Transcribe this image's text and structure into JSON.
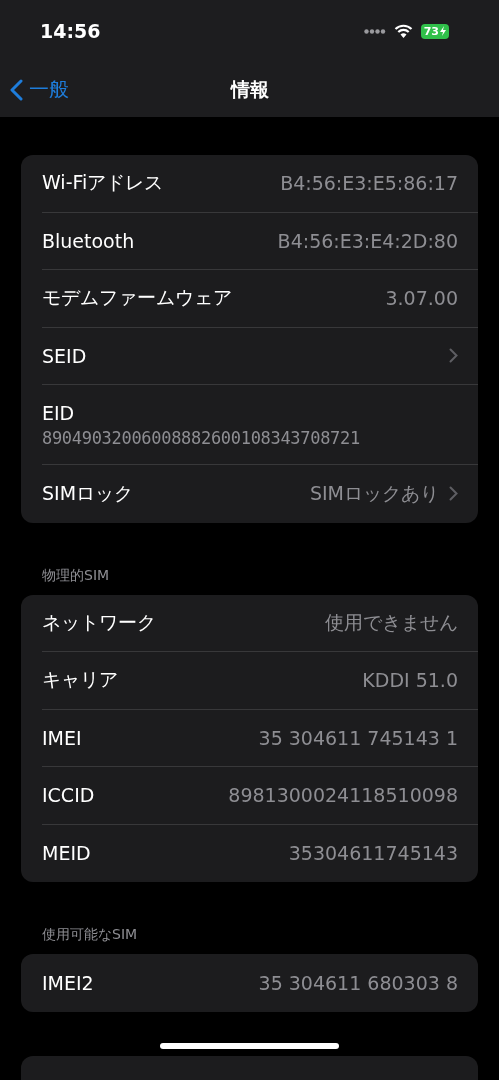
{
  "status_bar": {
    "time": "14:56",
    "battery": "73",
    "charging": true
  },
  "nav": {
    "back": "一般",
    "title": "情報"
  },
  "sections": [
    {
      "rows": [
        {
          "kind": "detail",
          "label": "Wi-Fiアドレス",
          "value": "B4:56:E3:E5:86:17"
        },
        {
          "kind": "detail",
          "label": "Bluetooth",
          "value": "B4:56:E3:E4:2D:80"
        },
        {
          "kind": "detail",
          "label": "モデムファームウェア",
          "value": "3.07.00"
        },
        {
          "kind": "link",
          "label": "SEID"
        },
        {
          "kind": "stacked",
          "label": "EID",
          "value": "89049032006008882600108343708721"
        },
        {
          "kind": "link",
          "label": "SIMロック",
          "value": "SIMロックあり"
        }
      ]
    },
    {
      "header": "物理的SIM",
      "rows": [
        {
          "kind": "detail",
          "label": "ネットワーク",
          "value": "使用できません"
        },
        {
          "kind": "detail",
          "label": "キャリア",
          "value": "KDDI 51.0"
        },
        {
          "kind": "detail",
          "label": "IMEI",
          "value": "35 304611 745143 1"
        },
        {
          "kind": "detail",
          "label": "ICCID",
          "value": "8981300024118510098"
        },
        {
          "kind": "detail",
          "label": "MEID",
          "value": "35304611745143"
        }
      ]
    },
    {
      "header": "使用可能なSIM",
      "rows": [
        {
          "kind": "detail",
          "label": "IMEI2",
          "value": "35 304611 680303 8"
        }
      ]
    }
  ]
}
